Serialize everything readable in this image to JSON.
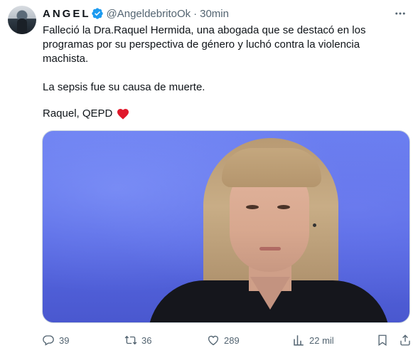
{
  "author": {
    "name": "ANGEL",
    "handle": "@AngeldebritoOk",
    "separator": "·",
    "time": "30min",
    "verified": true
  },
  "tweet": {
    "paragraph1": "Falleció la Dra.Raquel Hermida, una abogada que se destacó en los programas por su perspectiva de  género y luchó contra la violencia machista.",
    "paragraph2": "La sepsis fue su causa de muerte.",
    "paragraph3": "Raquel, QEPD"
  },
  "media": {
    "background": "#5667e2"
  },
  "actions": {
    "replies": "39",
    "retweets": "36",
    "likes": "289",
    "views": "22 mil"
  },
  "colors": {
    "accent": "#1d9bf0",
    "heart": "#f4212e",
    "secondary_text": "#536471"
  },
  "icons": [
    "more-icon",
    "verified-badge-icon",
    "heart-emoji-icon",
    "reply-icon",
    "retweet-icon",
    "like-icon",
    "views-icon",
    "bookmark-icon",
    "share-icon"
  ]
}
